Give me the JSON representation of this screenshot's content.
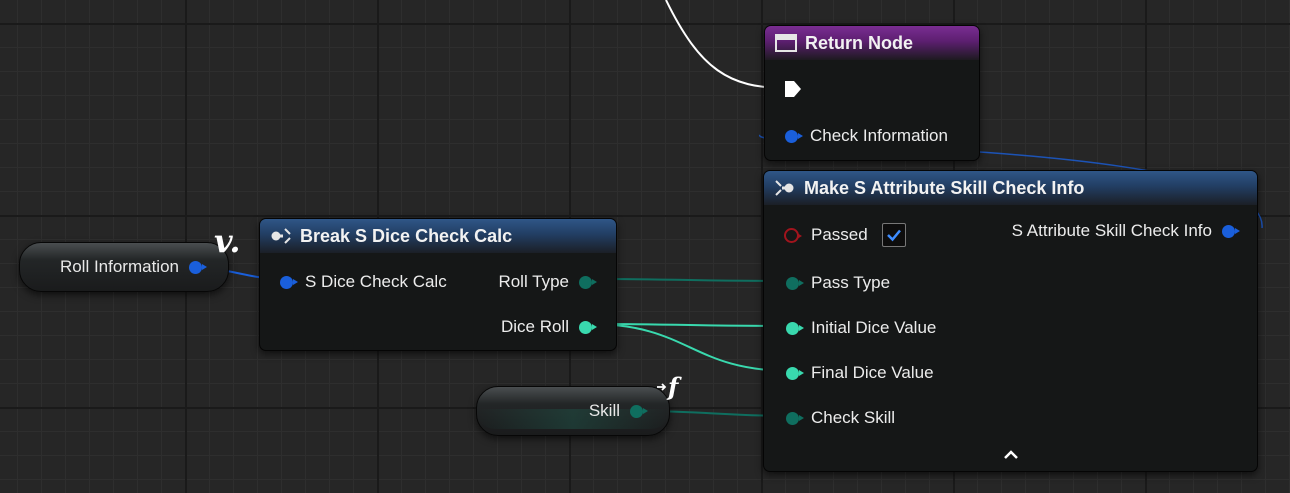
{
  "return_node": {
    "title": "Return Node",
    "pins": {
      "check_information": "Check Information"
    }
  },
  "break_node": {
    "title": "Break S Dice Check Calc",
    "pins": {
      "input": "S Dice Check Calc",
      "roll_type": "Roll Type",
      "dice_roll": "Dice Roll"
    }
  },
  "make_node": {
    "title": "Make S Attribute Skill Check Info",
    "pins": {
      "passed": "Passed",
      "output": "S Attribute Skill Check Info",
      "pass_type": "Pass Type",
      "initial_dice_value": "Initial Dice Value",
      "final_dice_value": "Final Dice Value",
      "check_skill": "Check Skill"
    },
    "passed_checked": true,
    "collapse_icon": "chevron-up-icon"
  },
  "variables": {
    "roll_information": "Roll Information",
    "skill": "Skill",
    "local_badge": "v.",
    "function_badge": "f"
  },
  "colors": {
    "struct_pin": "#1a5fdb",
    "byte_pin": "#0f6e5f",
    "int_pin": "#39d9ae",
    "bool_pin": "#a1141d",
    "header_function": "#2f5687",
    "header_return": "#7a2d92",
    "exec_wire": "#ffffff"
  }
}
